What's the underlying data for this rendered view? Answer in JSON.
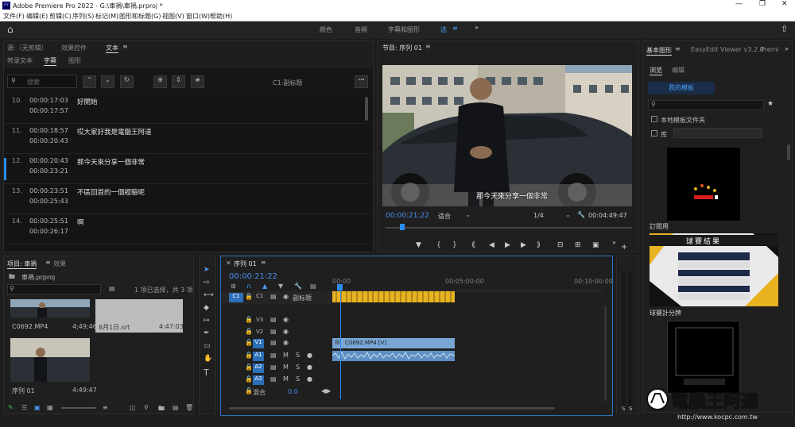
{
  "title": "Adobe Premiere Pro 2022 - G:\\車禍\\車禍.prproj *",
  "menu": [
    "文件(F)",
    "编辑(E)",
    "剪辑(C)",
    "序列(S)",
    "标记(M)",
    "图形和标题(G)",
    "视图(V)",
    "窗口(W)",
    "帮助(H)"
  ],
  "workspaces": [
    "颜色",
    "音频",
    "字幕和图形",
    "选"
  ],
  "source": {
    "tabs": [
      "源:（无剪辑）",
      "效果控件",
      "文本"
    ],
    "subtabs": [
      "转录文本",
      "字幕",
      "图形"
    ],
    "search_placeholder": "搜索",
    "track_label": "C1:副标题",
    "captions": [
      {
        "n": "10.",
        "start": "00:00:17:03",
        "end": "00:00:17:57",
        "text": "好開始"
      },
      {
        "n": "11.",
        "start": "00:00:18:57",
        "end": "00:00:20:43",
        "text": "哎大家好我是電腦王阿達"
      },
      {
        "n": "12.",
        "start": "00:00:20:43",
        "end": "00:00:23:21",
        "text": "那今天來分享一個非常"
      },
      {
        "n": "13.",
        "start": "00:00:23:51",
        "end": "00:00:25:43",
        "text": "不區回首的一個經驗呢"
      },
      {
        "n": "14.",
        "start": "00:00:25:51",
        "end": "00:00:26:17",
        "text": "啊"
      }
    ]
  },
  "program": {
    "tab": "节目: 序列 01",
    "subtitle": "那今天來分享一個非常",
    "timecode": "00:00:21:22",
    "fit": "适合",
    "ratio": "1/4",
    "duration": "00:04:49:47"
  },
  "graphics": {
    "tabs": [
      "基本图形",
      "EasyEdit Viewer v3.2.0",
      "Premi"
    ],
    "subtabs": [
      "浏览",
      "编辑"
    ],
    "my_templates": "我的模板",
    "local": "本地模板文件夹",
    "library": "库",
    "items": [
      "訂閱用",
      "球賽計分牌"
    ],
    "scoreboard_title": "球賽結果"
  },
  "project": {
    "tabs": [
      "项目: 車禍",
      "效果"
    ],
    "file": "車禍.prproj",
    "selection": "1 项已选择，共 3 项",
    "clips": [
      {
        "name": "C0692.MP4",
        "dur": "4;49;46"
      },
      {
        "name": "8月1日.srt",
        "dur": "4:47:03"
      },
      {
        "name": "序列 01",
        "dur": "4:49:47"
      }
    ]
  },
  "timeline": {
    "tab": "序列 01",
    "timecode": "00:00:21:22",
    "rulers": [
      "00:00",
      "00:05:00:00",
      "00:10:00:00"
    ],
    "subtitle_track": "副标题",
    "tracks": [
      "C1",
      "V3",
      "V2",
      "V1",
      "A1",
      "A2",
      "A3"
    ],
    "clip_label": "C0692.MP4 [V]",
    "mix": "混合",
    "mix_val": "0.0"
  },
  "watermark": {
    "site": "電腦王阿達",
    "url": "http://www.kocpc.com.tw"
  },
  "colors": {
    "accent": "#2d8cf0",
    "caption_bar": "#e8b321",
    "clip": "#7aa6d6"
  }
}
